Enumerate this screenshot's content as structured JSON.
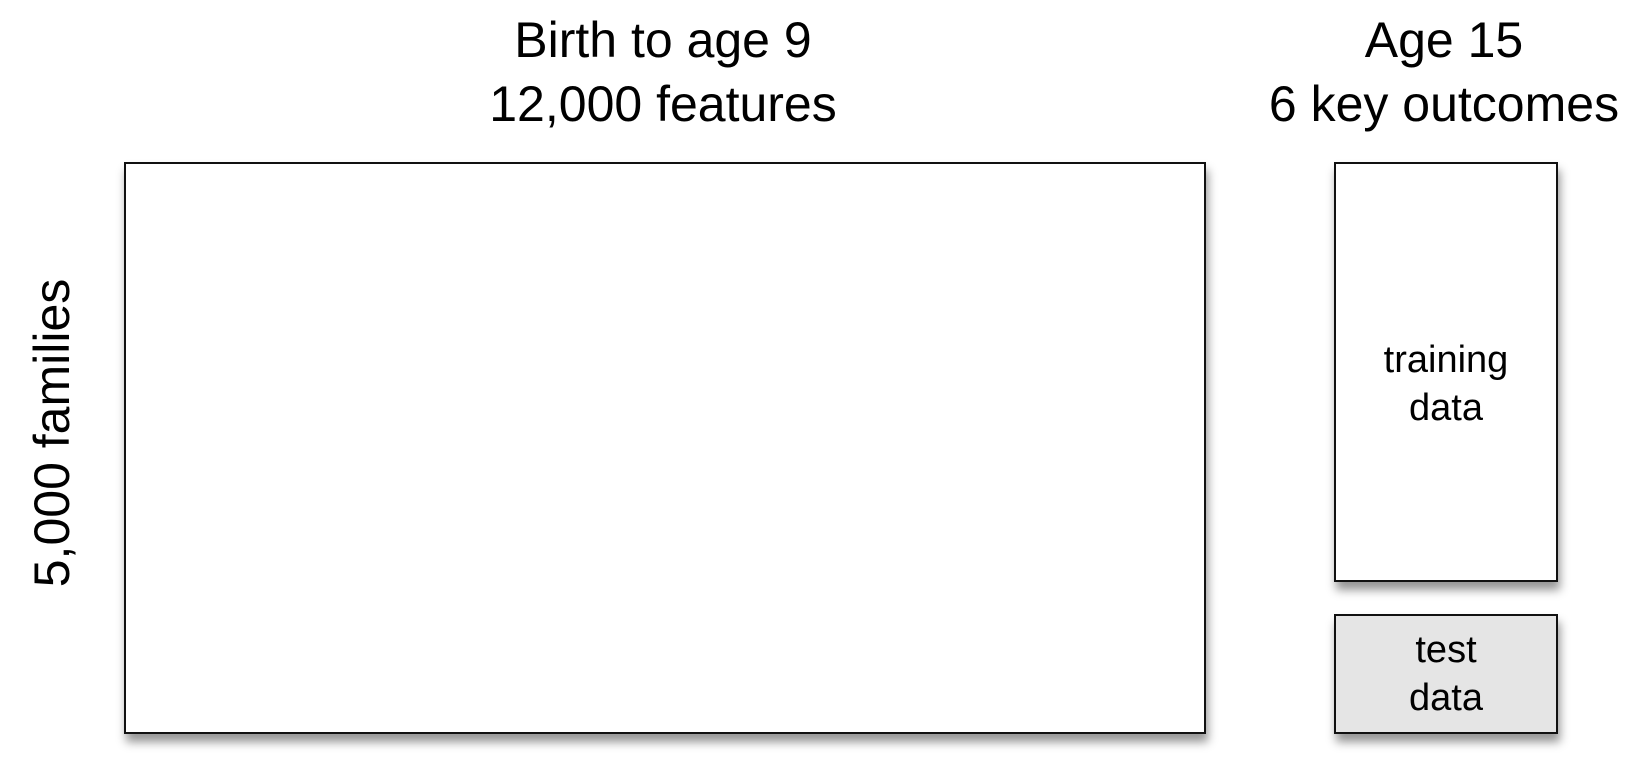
{
  "features_heading": {
    "line1": "Birth to age 9",
    "line2": "12,000 features"
  },
  "outcomes_heading": {
    "line1": "Age 15",
    "line2": "6 key outcomes"
  },
  "rows_label": "5,000 families",
  "training_box": {
    "line1": "training",
    "line2": "data"
  },
  "test_box": {
    "line1": "test",
    "line2": "data",
    "fill_color": "#e5e5e5"
  }
}
